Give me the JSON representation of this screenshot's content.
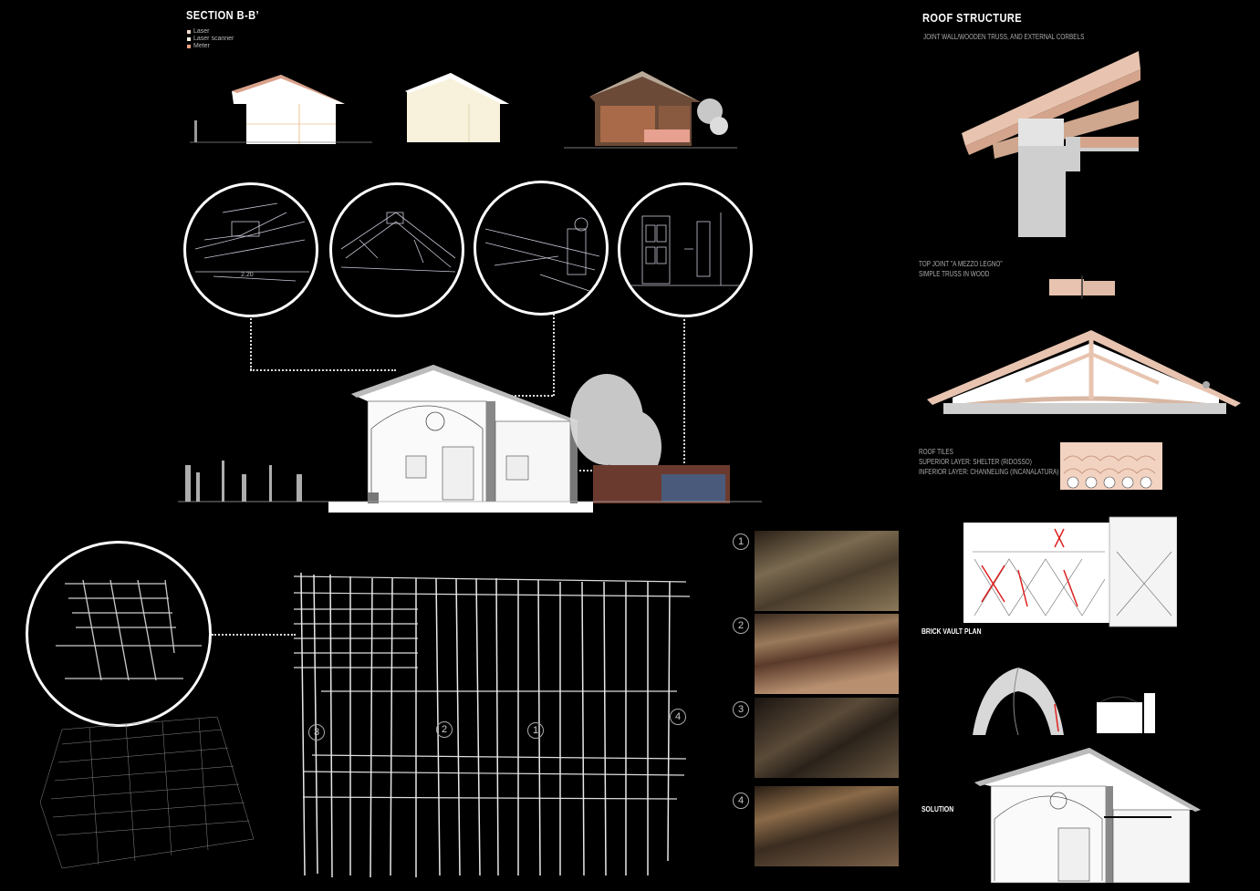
{
  "section": {
    "title": "SECTION B-B’",
    "legend": [
      {
        "label": "Laser",
        "color": "#f2d9c8"
      },
      {
        "label": "Laser scanner",
        "color": "#f5efe0"
      },
      {
        "label": "Meter",
        "color": "#e8a080"
      }
    ]
  },
  "roof_structure": {
    "title": "ROOF STRUCTURE",
    "subtitle": "JOINT WALL/WOODEN TRUSS, AND EXTERNAL CORBELS",
    "top_joint_line1": "TOP JOINT \"A MEZZO LEGNO\"",
    "top_joint_line2": "SIMPLE TRUSS IN WOOD",
    "roof_tiles_line1": "ROOF TILES",
    "roof_tiles_line2": "SUPERIOR LAYER: SHELTER (RIDOSSO)",
    "roof_tiles_line3": "INFERIOR LAYER: CHANNELING (INCANALATURA)"
  },
  "brick_vault_plan": {
    "label": "BRICK VAULT PLAN"
  },
  "solution": {
    "label": "SOLUTION"
  },
  "photos": [
    {
      "num": "1"
    },
    {
      "num": "2"
    },
    {
      "num": "3"
    },
    {
      "num": "4"
    }
  ],
  "plan_markers": [
    {
      "num": "3"
    },
    {
      "num": "2"
    },
    {
      "num": "1"
    },
    {
      "num": "4"
    }
  ],
  "colors": {
    "wood": "#d9b8a4",
    "wall": "#cfcfcf",
    "crack": "#e02020"
  }
}
